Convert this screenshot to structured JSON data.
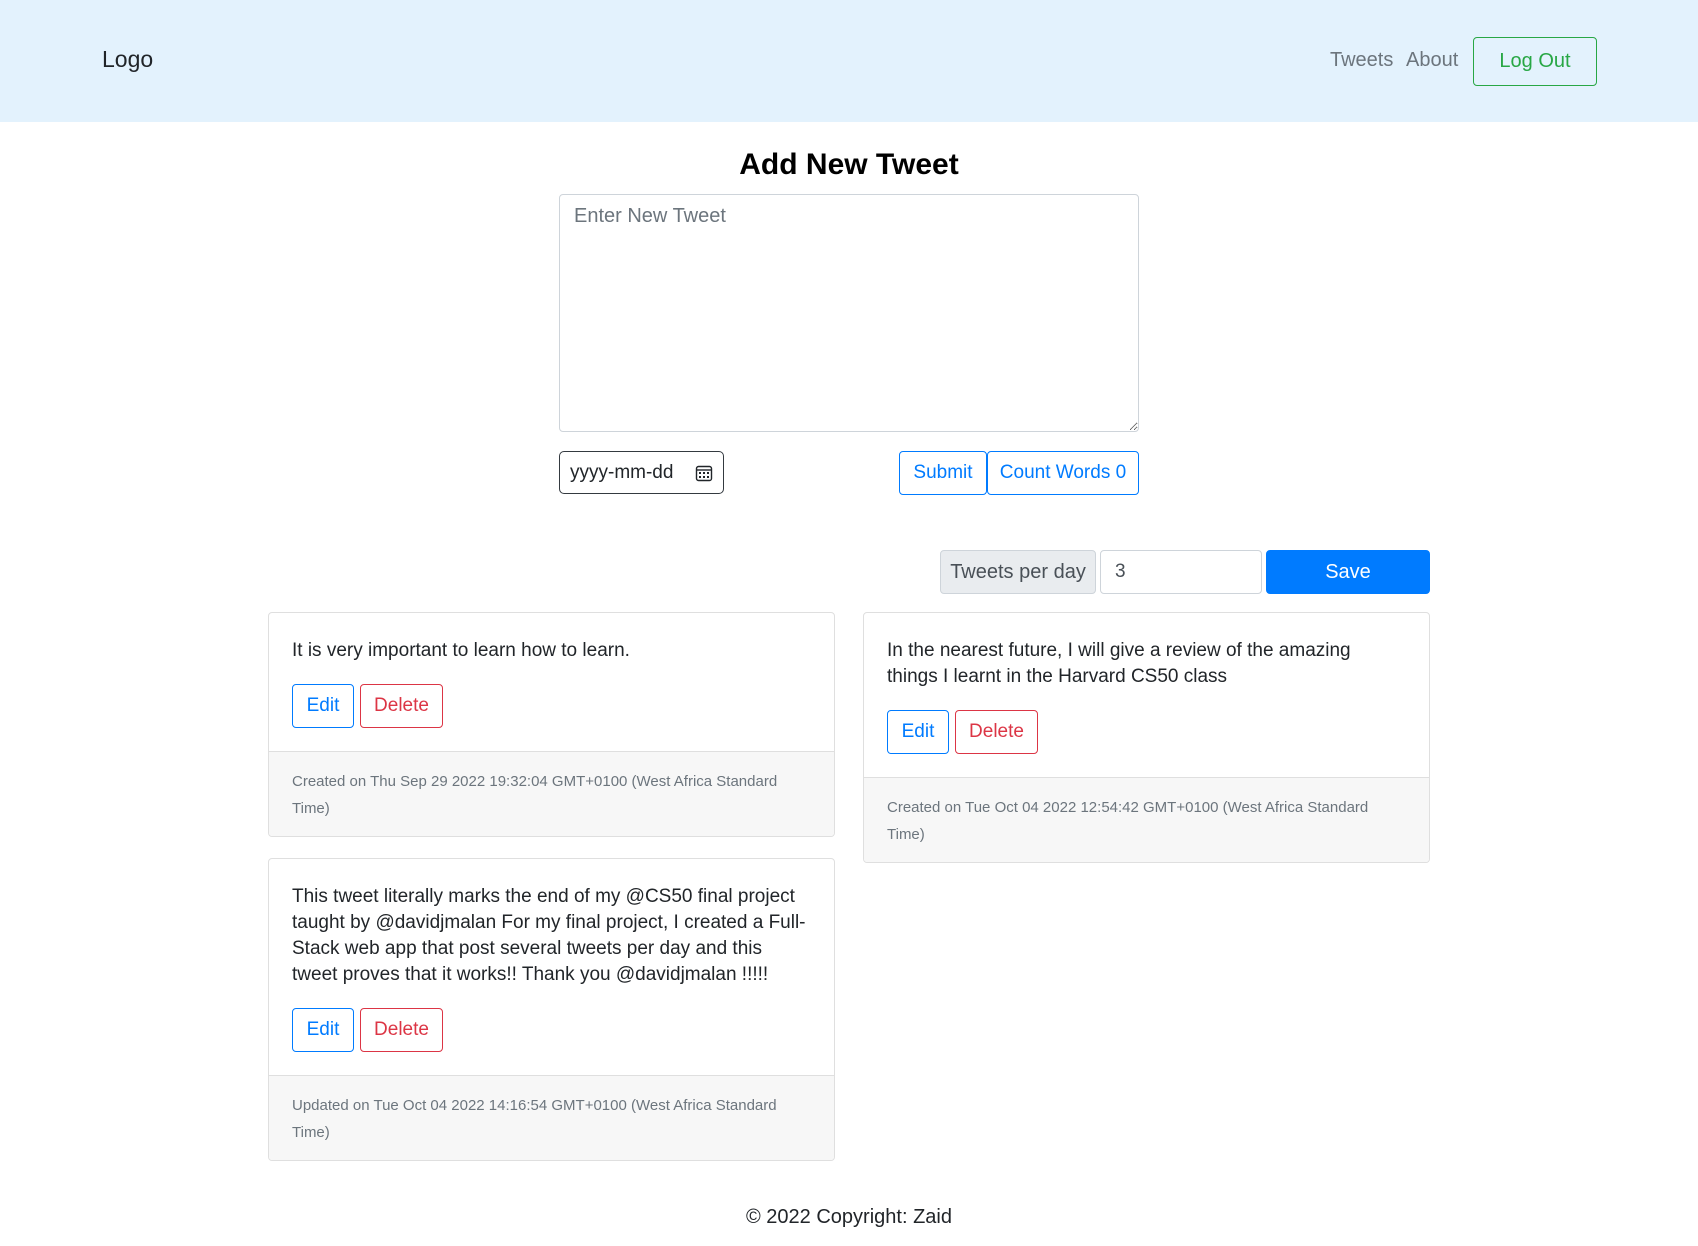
{
  "navbar": {
    "logo": "Logo",
    "links": [
      "Tweets",
      "About"
    ],
    "logout_label": "Log Out"
  },
  "compose": {
    "title": "Add New Tweet",
    "placeholder": "Enter New Tweet",
    "date_placeholder": "yyyy-mm-dd",
    "submit_label": "Submit",
    "count_label": "Count Words 0"
  },
  "settings": {
    "tweets_per_day_label": "Tweets per day",
    "tweets_per_day_value": "3",
    "save_label": "Save"
  },
  "tweets": [
    {
      "text": "It is very important to learn how to learn.",
      "edit_label": "Edit",
      "delete_label": "Delete",
      "footer": "Created on Thu Sep 29 2022 19:32:04 GMT+0100 (West Africa Standard Time)"
    },
    {
      "text": "In the nearest future, I will give a review of the amazing things I learnt in the Harvard CS50 class",
      "edit_label": "Edit",
      "delete_label": "Delete",
      "footer": "Created on Tue Oct 04 2022 12:54:42 GMT+0100 (West Africa Standard Time)"
    },
    {
      "text": "This tweet literally marks the end of my @CS50 final project taught by @davidjmalan For my final project, I created a Full-Stack web app that post several tweets per day and this tweet proves that it works!! Thank you @davidjmalan !!!!!",
      "edit_label": "Edit",
      "delete_label": "Delete",
      "footer": "Updated on Tue Oct 04 2022 14:16:54 GMT+0100 (West Africa Standard Time)"
    }
  ],
  "footer": {
    "copyright": "© 2022 Copyright: Zaid"
  },
  "colors": {
    "navbar_bg": "#e3f2fd",
    "primary": "#007bff",
    "success": "#28a745",
    "danger": "#dc3545"
  }
}
